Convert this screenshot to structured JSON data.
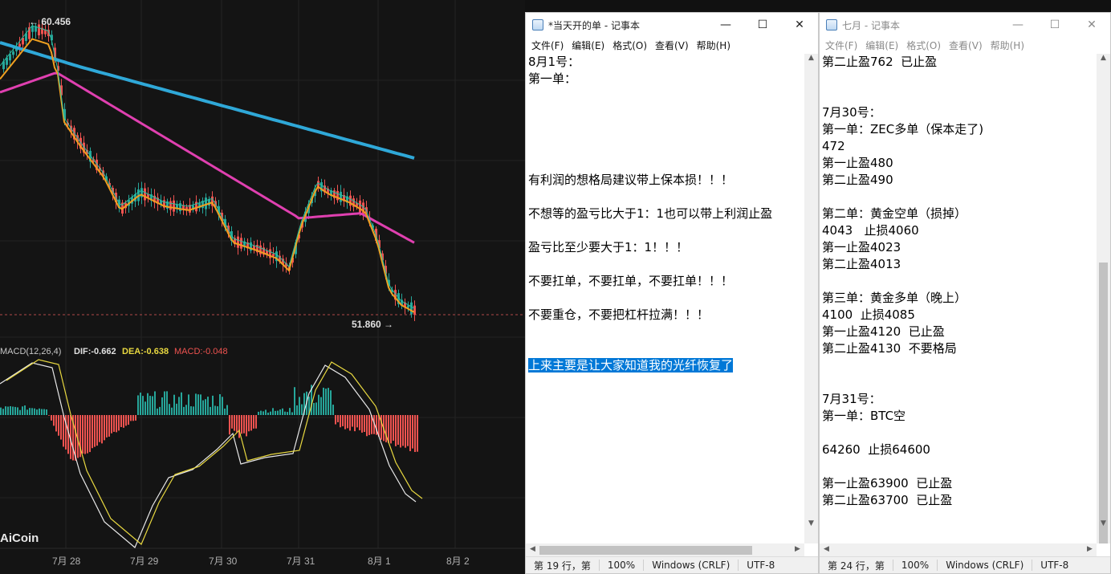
{
  "chart": {
    "high_label": "← 60.456",
    "low_label": "51.860 →",
    "macd_title": "MACD(12,26,4)",
    "dif_label": "DIF:-0.662",
    "dea_label": "DEA:-0.638",
    "macd_label": "MACD:-0.048",
    "watermark": "AiCoin",
    "date_labels": [
      "7月 28",
      "7月 29",
      "7月 30",
      "7月 31",
      "8月 1",
      "8月 2"
    ],
    "colors": {
      "up": "#26a69a",
      "down": "#ef5350",
      "ma_blue": "#2fa8d8",
      "ma_pink": "#e040b0",
      "ma_orange": "#f0a020",
      "ma_teal": "#2bc0a0",
      "dif": "#e8e8e8",
      "dea": "#e8d840"
    }
  },
  "notepad1": {
    "title": "*当天开的单 - 记事本",
    "menu": [
      "文件(F)",
      "编辑(E)",
      "格式(O)",
      "查看(V)",
      "帮助(H)"
    ],
    "lines": [
      "8月1号：",
      "第一单：",
      "",
      "",
      "",
      "",
      "",
      "有利润的想格局建议带上保本损！！！",
      "",
      "不想等的盈亏比大于1：1也可以带上利润止盈",
      "",
      "盈亏比至少要大于1：1！！！",
      "",
      "不要扛单，不要扛单，不要扛单！！！",
      "",
      "不要重仓，不要把杠杆拉满！！！",
      "",
      "",
      "上来主要是让大家知道我的光纤恢复了"
    ],
    "status": {
      "position": "第 19 行，第",
      "zoom": "100%",
      "eol": "Windows (CRLF)",
      "encoding": "UTF-8"
    }
  },
  "notepad2": {
    "title": "七月 - 记事本",
    "menu": [
      "文件(F)",
      "编辑(E)",
      "格式(O)",
      "查看(V)",
      "帮助(H)"
    ],
    "lines": [
      "第二止盈762  已止盈",
      "",
      "",
      "7月30号：",
      "第一单：ZEC多单（保本走了)",
      "472",
      "第一止盈480",
      "第二止盈490",
      "",
      "第二单：黄金空单（损掉）",
      "4043   止损4060",
      "第一止盈4023",
      "第二止盈4013",
      "",
      "第三单：黄金多单（晚上）",
      "4100  止损4085",
      "第一止盈4120  已止盈",
      "第二止盈4130  不要格局",
      "",
      "",
      "7月31号：",
      "第一单：BTC空",
      "",
      "64260  止损64600",
      "",
      "第一止盈63900  已止盈",
      "第二止盈63700  已止盈"
    ],
    "status": {
      "position": "第 24 行，第",
      "zoom": "100%",
      "eol": "Windows (CRLF)",
      "encoding": "UTF-8"
    }
  }
}
